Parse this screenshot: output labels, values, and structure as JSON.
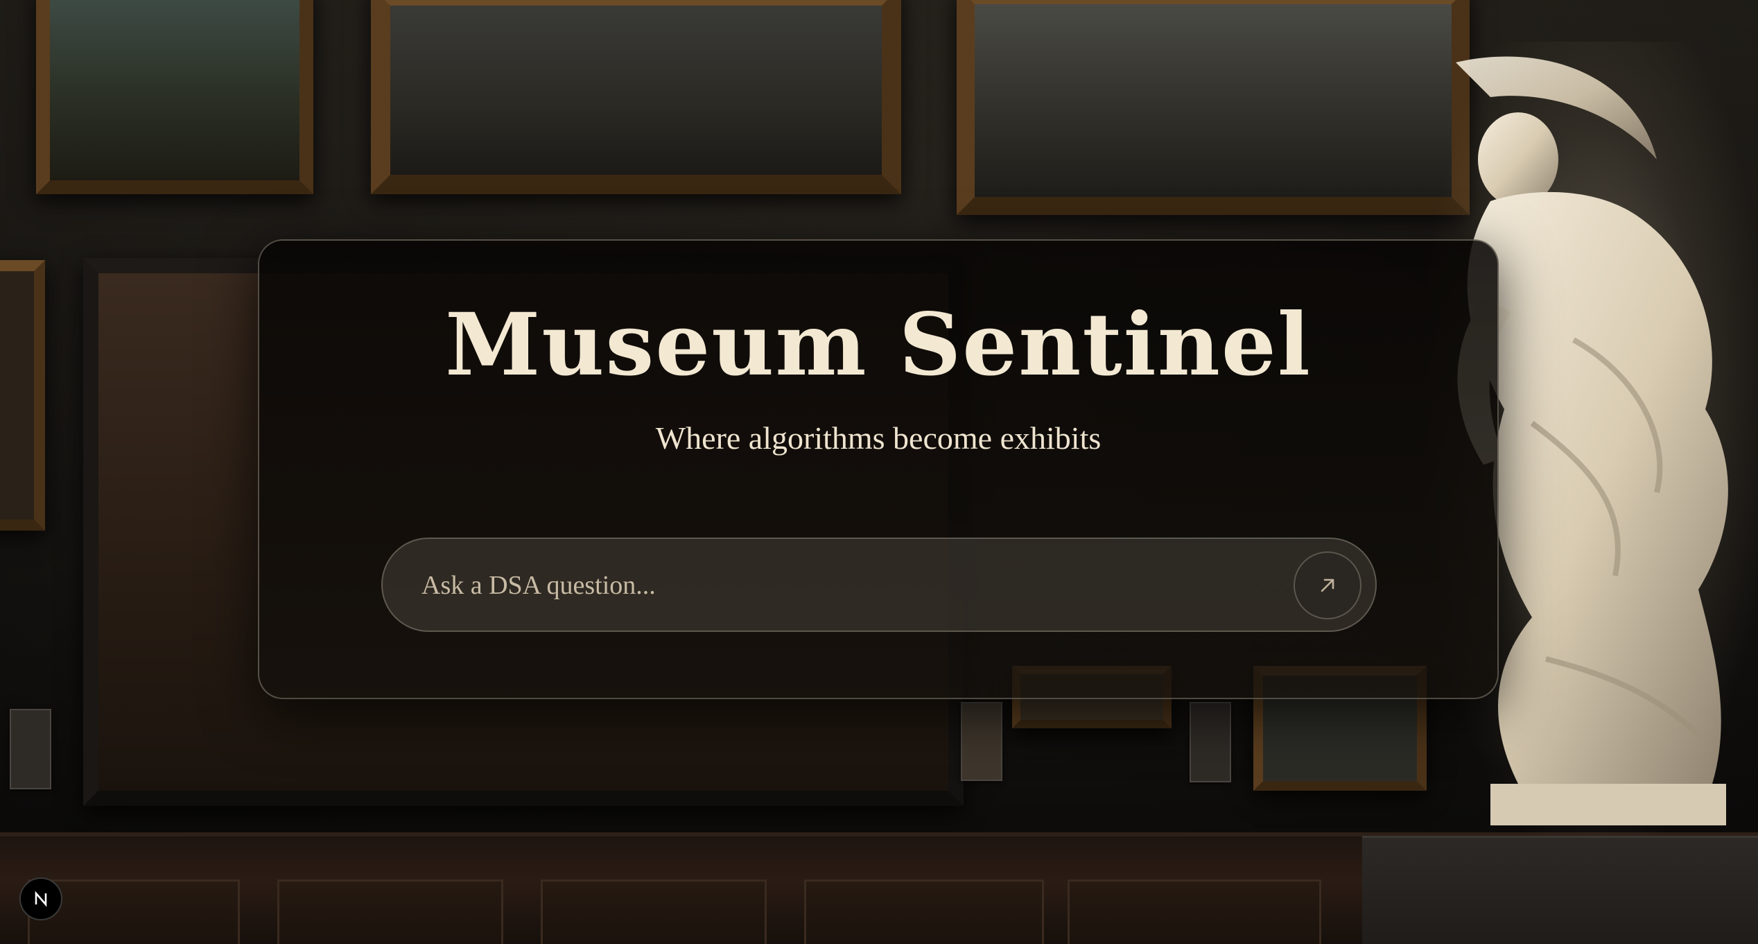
{
  "app": {
    "title": "Museum Sentinel",
    "subtitle": "Where algorithms become exhibits"
  },
  "search": {
    "placeholder": "Ask a DSA question...",
    "value": "",
    "submit_icon": "arrow-up-right-icon"
  },
  "badge": {
    "icon": "nextjs-logo-icon"
  },
  "colors": {
    "title_text": "#f3e8d2",
    "card_border": "#d2c8b4",
    "card_background": "#0a0806",
    "background": "#1a1814"
  }
}
